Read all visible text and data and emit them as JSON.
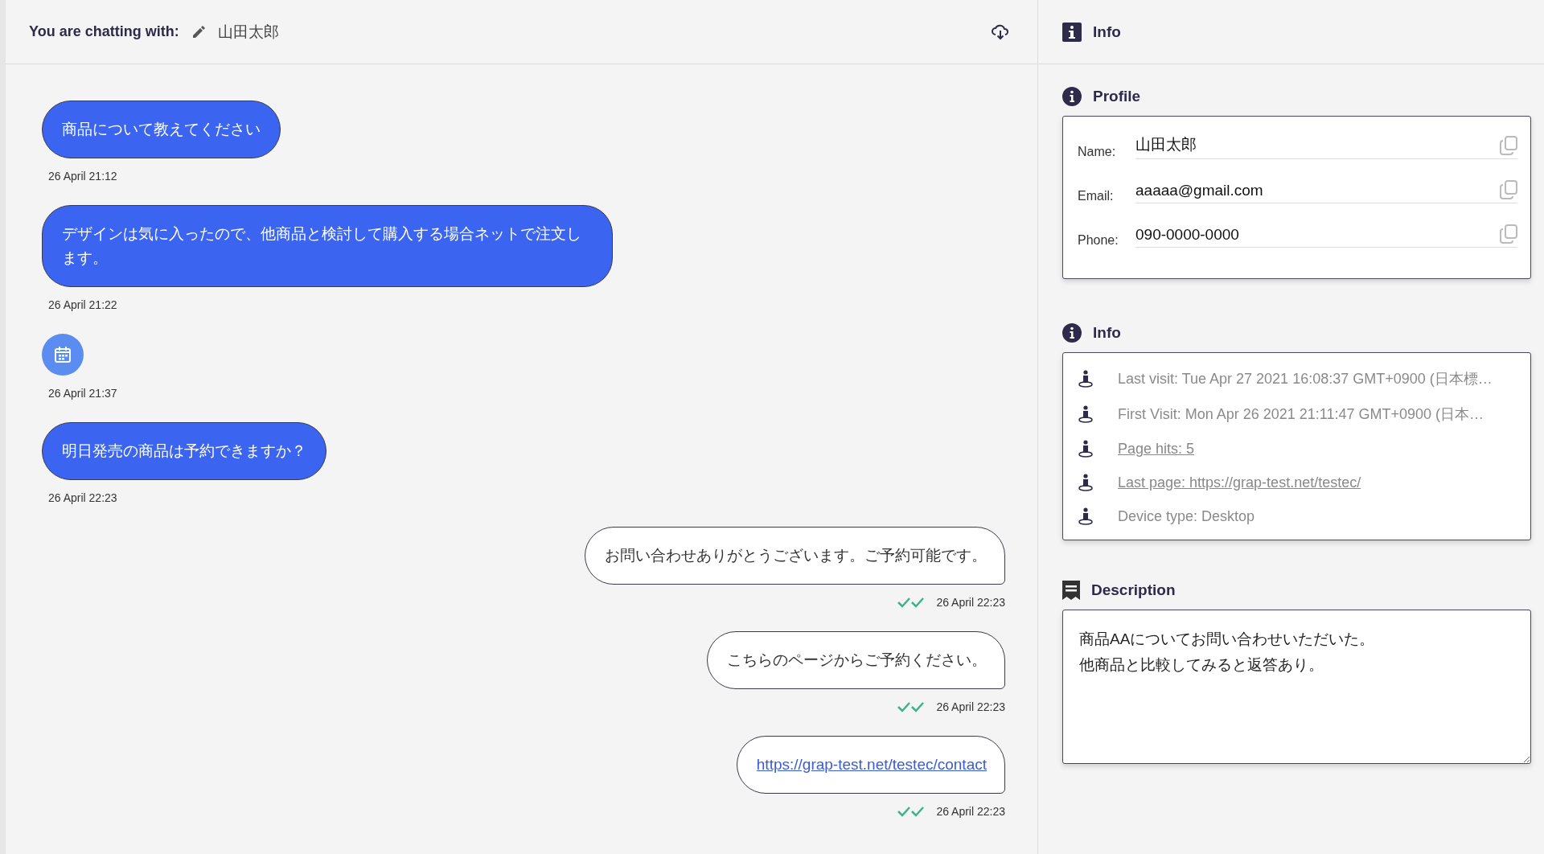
{
  "chat_header": {
    "label": "You are chatting with:",
    "contact_name": "山田太郎"
  },
  "messages": [
    {
      "outgoing": false,
      "kind": "text",
      "text": "商品について教えてください",
      "time": "26 April 21:12"
    },
    {
      "outgoing": false,
      "kind": "text",
      "text": "デザインは気に入ったので、他商品と検討して購入する場合ネットで注文します。",
      "time": "26 April 21:22"
    },
    {
      "outgoing": false,
      "kind": "attachment",
      "time": "26 April 21:37"
    },
    {
      "outgoing": false,
      "kind": "text",
      "text": "明日発売の商品は予約できますか？",
      "time": "26 April 22:23"
    },
    {
      "outgoing": true,
      "kind": "text",
      "text": "お問い合わせありがとうございます。ご予約可能です。",
      "time": "26 April 22:23",
      "read": true
    },
    {
      "outgoing": true,
      "kind": "text",
      "text": "こちらのページからご予約ください。",
      "time": "26 April 22:23",
      "read": true
    },
    {
      "outgoing": true,
      "kind": "link",
      "text": "https://grap-test.net/testec/contact",
      "time": "26 April 22:23",
      "read": true
    }
  ],
  "sidebar": {
    "title": "Info",
    "profile": {
      "title": "Profile",
      "fields": [
        {
          "label": "Name:",
          "value": "山田太郎"
        },
        {
          "label": "Email:",
          "value": "aaaaa@gmail.com"
        },
        {
          "label": "Phone:",
          "value": "090-0000-0000"
        }
      ]
    },
    "info": {
      "title": "Info",
      "rows": [
        {
          "kind": "text",
          "text": "Last visit: Tue Apr 27 2021 16:08:37 GMT+0900 (日本標…"
        },
        {
          "kind": "text",
          "text": "First Visit: Mon Apr 26 2021 21:11:47 GMT+0900 (日本…"
        },
        {
          "kind": "link",
          "text": "Page hits: 5"
        },
        {
          "kind": "link",
          "text": "Last page: https://grap-test.net/testec/"
        },
        {
          "kind": "text",
          "text": "Device type: Desktop"
        }
      ]
    },
    "description": {
      "title": "Description",
      "lines": [
        "商品AAについてお問い合わせいただいた。",
        "他商品と比較してみると返答あり。"
      ]
    }
  }
}
